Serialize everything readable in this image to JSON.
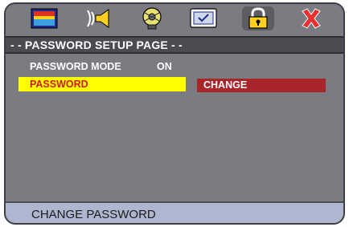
{
  "icons": [
    {
      "name": "picture-icon"
    },
    {
      "name": "audio-icon"
    },
    {
      "name": "video-icon"
    },
    {
      "name": "preference-icon"
    },
    {
      "name": "lock-icon",
      "selected": true
    },
    {
      "name": "exit-icon"
    }
  ],
  "header": {
    "title": "- - PASSWORD SETUP  PAGE  - -"
  },
  "rows": {
    "password_mode": {
      "label": "PASSWORD MODE",
      "value": "ON"
    },
    "password": {
      "label": "PASSWORD",
      "action": "CHANGE"
    }
  },
  "status": {
    "text": "CHANGE PASSWORD"
  },
  "colors": {
    "highlight": "#ffff00",
    "highlight_text": "#d01818",
    "action_bg": "#a8252a",
    "panel": "#7a7c82",
    "status_bar": "#aeb7cf"
  }
}
